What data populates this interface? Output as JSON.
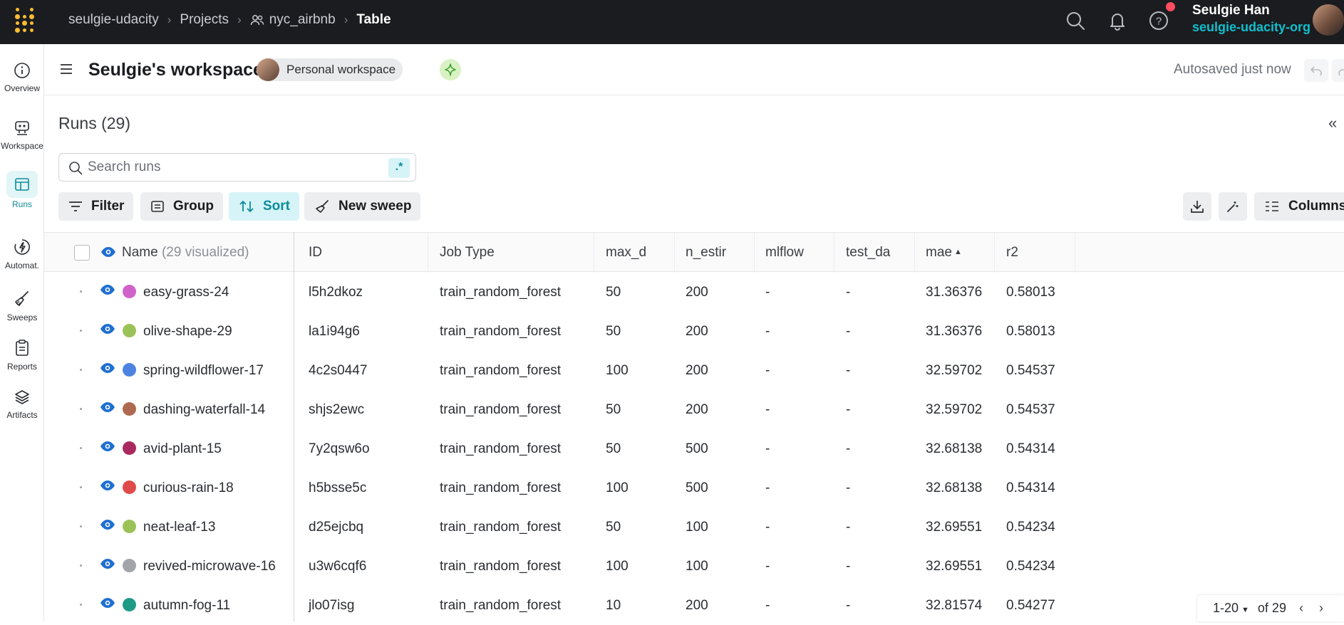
{
  "topbar": {
    "breadcrumbs": [
      "seulgie-udacity",
      "Projects",
      "nyc_airbnb",
      "Table"
    ],
    "user_name": "Seulgie Han",
    "user_org": "seulgie-udacity-org",
    "icons": [
      "search-icon",
      "bell-icon",
      "help-icon"
    ]
  },
  "nav": {
    "items": [
      {
        "label": "Overview",
        "icon": "info-icon"
      },
      {
        "label": "Workspace",
        "icon": "workspace-icon"
      },
      {
        "label": "Runs",
        "icon": "table-icon"
      },
      {
        "label": "Automat.",
        "icon": "automation-icon"
      },
      {
        "label": "Sweeps",
        "icon": "broom-icon"
      },
      {
        "label": "Reports",
        "icon": "clipboard-icon"
      },
      {
        "label": "Artifacts",
        "icon": "layers-icon"
      }
    ]
  },
  "workspace": {
    "title": "Seulgie's workspace",
    "badge": "Personal workspace",
    "autosaved": "Autosaved just now",
    "more": "•••"
  },
  "runs": {
    "title": "Runs (29)",
    "search_placeholder": "Search runs",
    "regex_label": ".*",
    "filter_label": "Filter",
    "group_label": "Group",
    "sort_label": "Sort",
    "new_sweep_label": "New sweep",
    "columns_label": "Columns"
  },
  "table": {
    "name_header": "Name",
    "name_header_suffix": "(29 visualized)",
    "columns": [
      "ID",
      "Job Type",
      "max_d",
      "n_estir",
      "mlflow",
      "test_da",
      "mae",
      "r2"
    ],
    "rows": [
      {
        "name": "easy-grass-24",
        "color": "#d063c9",
        "id": "l5h2dkoz",
        "job_type": "train_random_forest",
        "max_d": "50",
        "n_estir": "200",
        "mlflow": "-",
        "test_da": "-",
        "mae": "31.36376",
        "r2": "0.58013"
      },
      {
        "name": "olive-shape-29",
        "color": "#9bc257",
        "id": "la1i94g6",
        "job_type": "train_random_forest",
        "max_d": "50",
        "n_estir": "200",
        "mlflow": "-",
        "test_da": "-",
        "mae": "31.36376",
        "r2": "0.58013"
      },
      {
        "name": "spring-wildflower-17",
        "color": "#4c83e0",
        "id": "4c2s0447",
        "job_type": "train_random_forest",
        "max_d": "100",
        "n_estir": "200",
        "mlflow": "-",
        "test_da": "-",
        "mae": "32.59702",
        "r2": "0.54537"
      },
      {
        "name": "dashing-waterfall-14",
        "color": "#ad6a51",
        "id": "shjs2ewc",
        "job_type": "train_random_forest",
        "max_d": "50",
        "n_estir": "200",
        "mlflow": "-",
        "test_da": "-",
        "mae": "32.59702",
        "r2": "0.54537"
      },
      {
        "name": "avid-plant-15",
        "color": "#a92a60",
        "id": "7y2qsw6o",
        "job_type": "train_random_forest",
        "max_d": "50",
        "n_estir": "500",
        "mlflow": "-",
        "test_da": "-",
        "mae": "32.68138",
        "r2": "0.54314"
      },
      {
        "name": "curious-rain-18",
        "color": "#df4a4a",
        "id": "h5bsse5c",
        "job_type": "train_random_forest",
        "max_d": "100",
        "n_estir": "500",
        "mlflow": "-",
        "test_da": "-",
        "mae": "32.68138",
        "r2": "0.54314"
      },
      {
        "name": "neat-leaf-13",
        "color": "#9bc257",
        "id": "d25ejcbq",
        "job_type": "train_random_forest",
        "max_d": "50",
        "n_estir": "100",
        "mlflow": "-",
        "test_da": "-",
        "mae": "32.69551",
        "r2": "0.54234"
      },
      {
        "name": "revived-microwave-16",
        "color": "#a1a4a9",
        "id": "u3w6cqf6",
        "job_type": "train_random_forest",
        "max_d": "100",
        "n_estir": "100",
        "mlflow": "-",
        "test_da": "-",
        "mae": "32.69551",
        "r2": "0.54234"
      },
      {
        "name": "autumn-fog-11",
        "color": "#1f9a85",
        "id": "jlo07isg",
        "job_type": "train_random_forest",
        "max_d": "10",
        "n_estir": "200",
        "mlflow": "-",
        "test_da": "-",
        "mae": "32.81574",
        "r2": "0.54277"
      }
    ]
  },
  "pager": {
    "range": "1-20",
    "total": "of 29"
  },
  "colors": {
    "accent": "#0d8b99",
    "topbar_bg": "#1a1c1f",
    "brand": "#fcbc32"
  }
}
